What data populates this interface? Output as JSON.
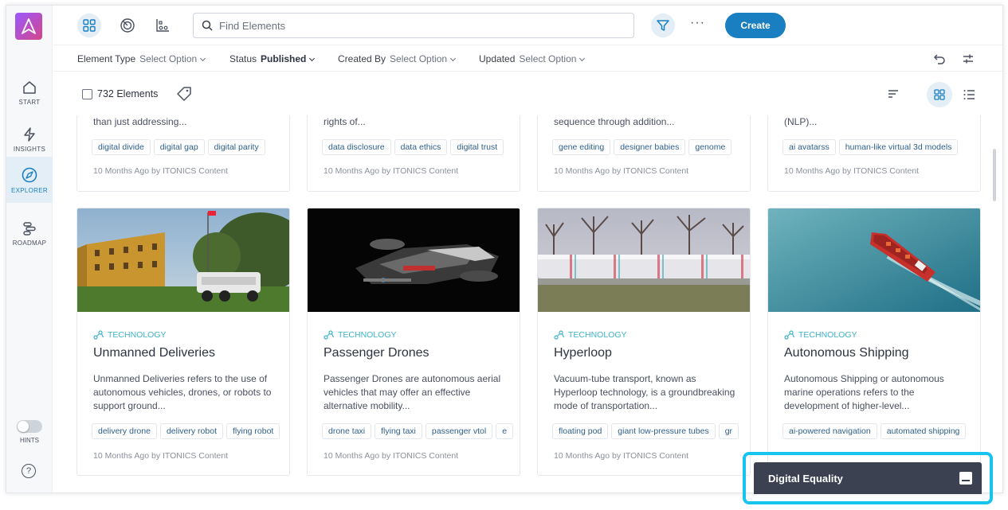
{
  "sidebar": {
    "items": [
      {
        "label": "START"
      },
      {
        "label": "INSIGHTS"
      },
      {
        "label": "EXPLORER"
      },
      {
        "label": "ROADMAP"
      }
    ],
    "hints_label": "HINTS",
    "help_glyph": "?"
  },
  "topbar": {
    "search_placeholder": "Find Elements",
    "more_glyph": "···",
    "create_label": "Create"
  },
  "filters": [
    {
      "key": "Element Type",
      "value": "Select Option"
    },
    {
      "key": "Status",
      "value": "Published"
    },
    {
      "key": "Created By",
      "value": "Select Option"
    },
    {
      "key": "Updated",
      "value": "Select Option"
    }
  ],
  "count_label": "732 Elements",
  "colors": {
    "accent": "#1a7fc1",
    "type": "#3fb3c9",
    "highlight": "#16c4ef",
    "panel": "#3b4150"
  },
  "top_cards": [
    {
      "desc": "than just addressing...",
      "tags": [
        "digital divide",
        "digital gap",
        "digital parity"
      ],
      "meta_time": "10 Months Ago",
      "meta_by": "by",
      "meta_author": "ITONICS Content"
    },
    {
      "desc": "rights of...",
      "tags": [
        "data disclosure",
        "data ethics",
        "digital trust"
      ],
      "meta_time": "10 Months Ago",
      "meta_by": "by",
      "meta_author": "ITONICS Content"
    },
    {
      "desc": "sequence through addition...",
      "tags": [
        "gene editing",
        "designer babies",
        "genome"
      ],
      "meta_time": "10 Months Ago",
      "meta_by": "by",
      "meta_author": "ITONICS Content"
    },
    {
      "desc": "(NLP)...",
      "tags": [
        "ai avatarss",
        "human-like virtual 3d models"
      ],
      "meta_time": "10 Months Ago",
      "meta_by": "by",
      "meta_author": "ITONICS Content"
    }
  ],
  "cards": [
    {
      "type": "TECHNOLOGY",
      "title": "Unmanned Deliveries",
      "desc": "Unmanned Deliveries refers to the use of autonomous vehicles, drones, or robots to support ground...",
      "tags": [
        "delivery drone",
        "delivery robot",
        "flying robot"
      ],
      "meta_time": "10 Months Ago",
      "meta_by": "by",
      "meta_author": "ITONICS Content"
    },
    {
      "type": "TECHNOLOGY",
      "title": "Passenger Drones",
      "desc": "Passenger Drones are autonomous aerial vehicles that may offer an effective alternative mobility...",
      "tags": [
        "drone taxi",
        "flying taxi",
        "passenger vtol",
        "e"
      ],
      "meta_time": "10 Months Ago",
      "meta_by": "by",
      "meta_author": "ITONICS Content"
    },
    {
      "type": "TECHNOLOGY",
      "title": "Hyperloop",
      "desc": "Vacuum-tube transport, known as Hyperloop technology, is a groundbreaking mode of transportation...",
      "tags": [
        "floating pod",
        "giant low-pressure tubes",
        "gr"
      ],
      "meta_time": "10 Months Ago",
      "meta_by": "by",
      "meta_author": "ITONICS Content"
    },
    {
      "type": "TECHNOLOGY",
      "title": "Autonomous Shipping",
      "desc": "Autonomous Shipping or autonomous marine operations refers to the development of higher-level...",
      "tags": [
        "ai-powered navigation",
        "automated shipping"
      ],
      "meta_time": "",
      "meta_by": "",
      "meta_author": ""
    }
  ],
  "panel": {
    "title": "Digital Equality"
  }
}
